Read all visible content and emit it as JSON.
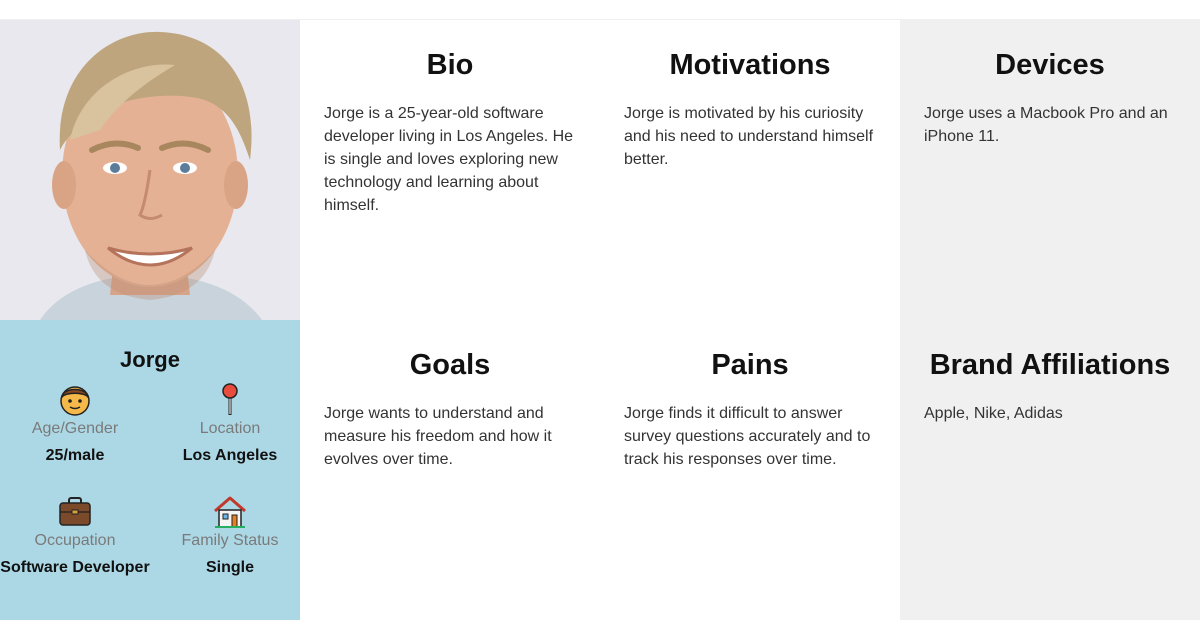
{
  "profile": {
    "name": "Jorge",
    "attributes": [
      {
        "label": "Age/Gender",
        "value": "25/male",
        "icon": "man-face-icon"
      },
      {
        "label": "Location",
        "value": "Los Angeles",
        "icon": "map-pin-icon"
      },
      {
        "label": "Occupation",
        "value": "Software Developer",
        "icon": "briefcase-icon"
      },
      {
        "label": "Family Status",
        "value": "Single",
        "icon": "house-icon"
      }
    ]
  },
  "sections": {
    "bio": {
      "title": "Bio",
      "text": "Jorge is a 25-year-old software developer living in Los Angeles. He is single and loves exploring new technology and learning about himself."
    },
    "motivations": {
      "title": "Motivations",
      "text": "Jorge is motivated by his curiosity and his need to understand himself better."
    },
    "devices": {
      "title": "Devices",
      "text": "Jorge uses a Macbook Pro and an iPhone 11."
    },
    "goals": {
      "title": "Goals",
      "text": "Jorge wants to understand and measure his freedom and how it evolves over time."
    },
    "pains": {
      "title": "Pains",
      "text": "Jorge finds it difficult to answer survey questions accurately and to track his responses over time."
    },
    "brands": {
      "title": "Brand Affiliations",
      "text": "Apple, Nike, Adidas"
    }
  },
  "colors": {
    "profile_bg": "#acd8e6",
    "grey_card_bg": "#f0f0f0",
    "label_text": "#7a7a7a"
  }
}
